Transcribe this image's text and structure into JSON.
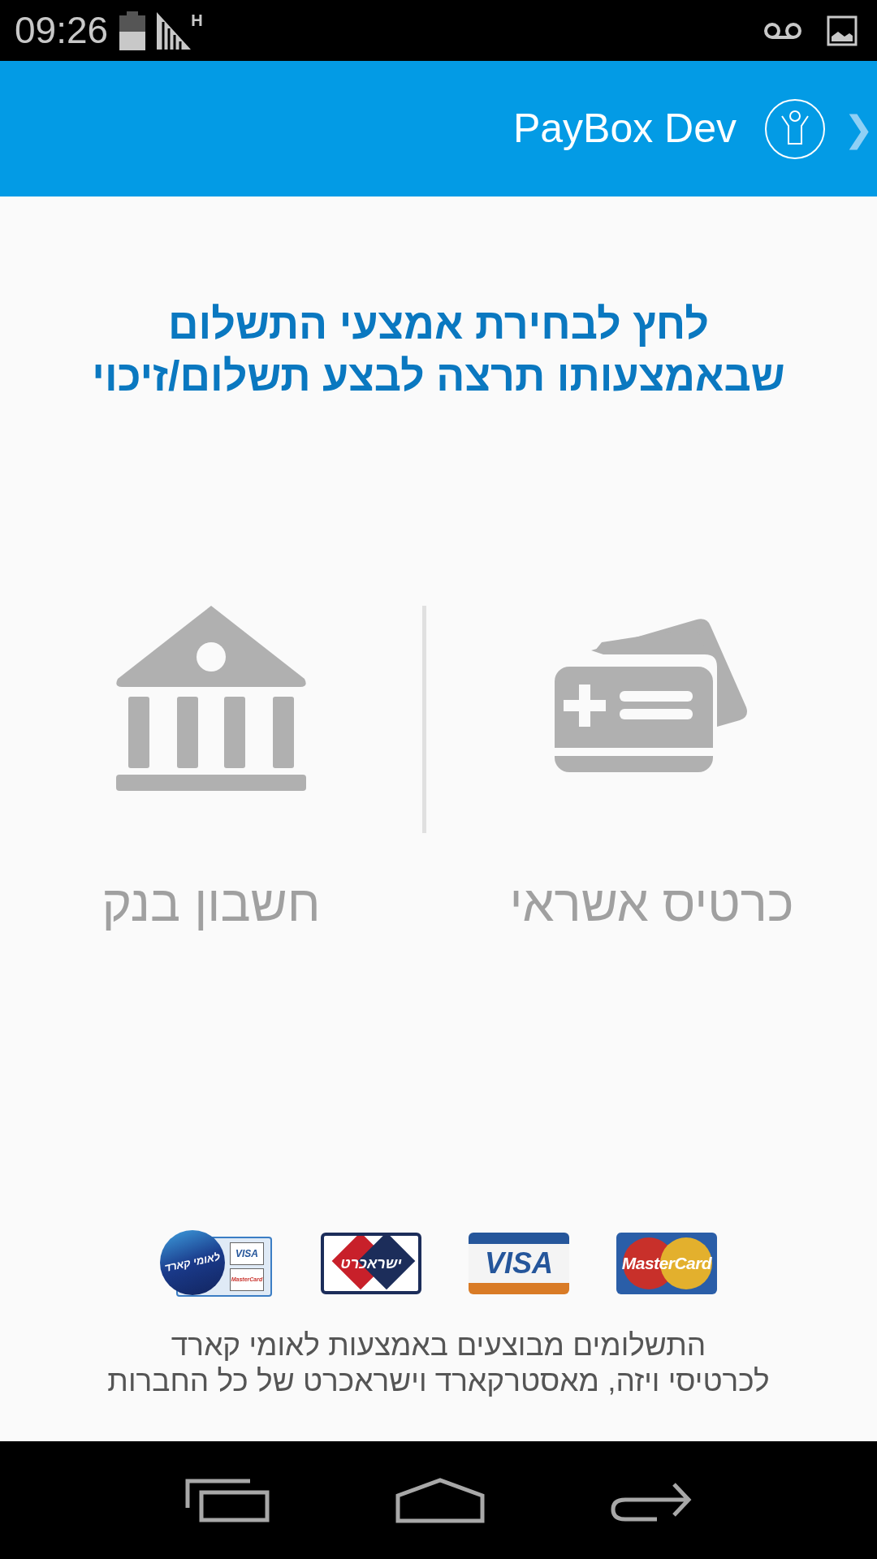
{
  "status_bar": {
    "time": "09:26",
    "network": "H"
  },
  "header": {
    "title": "PayBox Dev",
    "chevron": "❯"
  },
  "prompt": "לחץ לבחירת אמצעי התשלום שבאמצעותו תרצה לבצע תשלום/זיכוי",
  "options": [
    {
      "kind": "card",
      "label": "כרטיס אשראי"
    },
    {
      "kind": "bank",
      "label": "חשבון בנק"
    }
  ],
  "logos": [
    {
      "kind": "mastercard",
      "texts": [
        "MasterCard"
      ]
    },
    {
      "kind": "visa",
      "texts": [
        "VISA"
      ]
    },
    {
      "kind": "isracard",
      "texts": [
        "ישראכרט"
      ]
    },
    {
      "kind": "leumicard",
      "texts": [
        "לאומי קארד",
        "VISA",
        "MasterCard"
      ]
    }
  ],
  "footer": [
    "התשלומים מבוצעים באמצעות לאומי קארד",
    "לכרטיסי ויזה, מאסטרקארד וישראכרט של כל החברות"
  ]
}
